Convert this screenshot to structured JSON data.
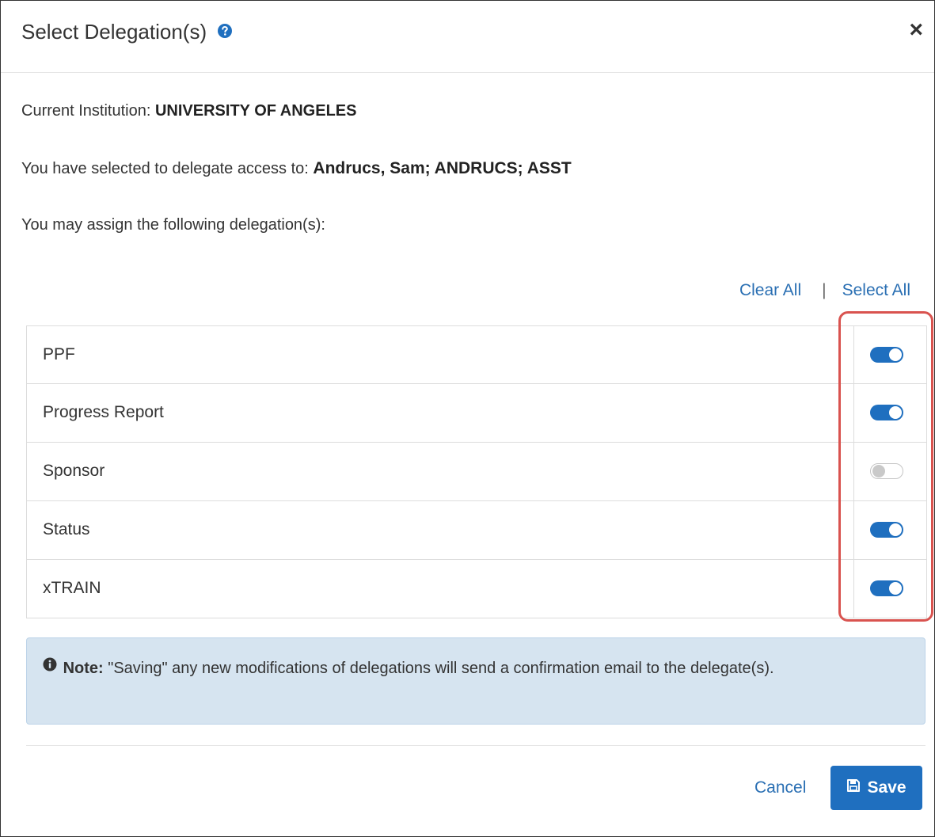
{
  "dialog": {
    "title": "Select Delegation(s)",
    "close_label": "×"
  },
  "institution": {
    "label": "Current Institution:",
    "value": "UNIVERSITY OF ANGELES"
  },
  "delegate": {
    "label": "You have selected to delegate access to:",
    "value": "Andrucs, Sam; ANDRUCS; ASST"
  },
  "assign_text": "You may assign the following delegation(s):",
  "links": {
    "clear_all": "Clear All",
    "separator": "|",
    "select_all": "Select All"
  },
  "delegations": [
    {
      "name": "PPF",
      "enabled": true
    },
    {
      "name": "Progress Report",
      "enabled": true
    },
    {
      "name": "Sponsor",
      "enabled": false
    },
    {
      "name": "Status",
      "enabled": true
    },
    {
      "name": "xTRAIN",
      "enabled": true
    }
  ],
  "note": {
    "label": "Note:",
    "text": "\"Saving\" any new modifications of delegations will send a confirmation email to the delegate(s)."
  },
  "footer": {
    "cancel": "Cancel",
    "save": "Save"
  },
  "colors": {
    "accent": "#1f6fbf",
    "link": "#2a6fb3",
    "note_bg": "#d6e4f0",
    "highlight": "#d9534f"
  },
  "icons": {
    "help": "question-circle-icon",
    "close": "close-icon",
    "info": "info-circle-icon",
    "save": "floppy-disk-icon"
  }
}
